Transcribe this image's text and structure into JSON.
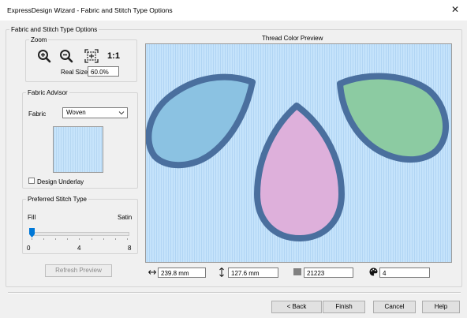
{
  "window": {
    "title": "ExpressDesign Wizard - Fabric and Stitch Type Options",
    "close_glyph": "✕"
  },
  "main_group": {
    "legend": "Fabric and Stitch Type Options"
  },
  "zoom": {
    "legend": "Zoom",
    "real_size_label": "Real Size",
    "real_size_value": "60.0%",
    "one_to_one": "1:1"
  },
  "fabric_advisor": {
    "legend": "Fabric Advisor",
    "fabric_label": "Fabric",
    "fabric_value": "Woven",
    "design_underlay_label": "Design Underlay",
    "design_underlay_checked": false
  },
  "stitch_type": {
    "legend": "Preferred Stitch Type",
    "fill_label": "Fill",
    "satin_label": "Satin",
    "min": "0",
    "mid": "4",
    "max": "8",
    "slider_value": 0
  },
  "refresh_button": "Refresh Preview",
  "preview": {
    "title": "Thread Color Preview",
    "fabric_color": "#c5e3fb",
    "outline_color": "#4a6f9e",
    "shape_colors": {
      "left": "#8fc6e4",
      "center": "#e2b4df",
      "right": "#91cfa6"
    }
  },
  "measurements": {
    "width": "239.8 mm",
    "height": "127.6 mm",
    "stitches": "21223",
    "colors": "4"
  },
  "footer": {
    "back": "< Back",
    "finish": "Finish",
    "cancel": "Cancel",
    "help": "Help"
  }
}
